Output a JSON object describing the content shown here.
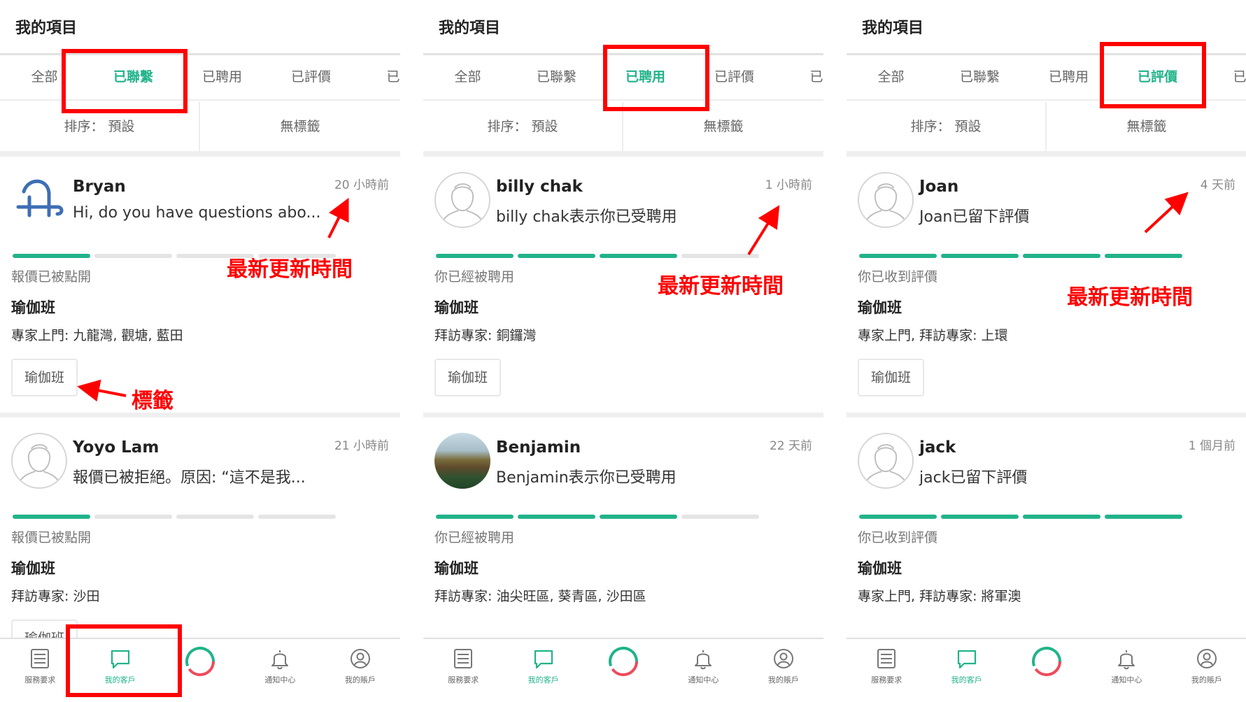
{
  "screens": [
    {
      "title": "我的項目",
      "tabs": [
        "全部",
        "已聯繫",
        "已聘用",
        "已評價",
        "已約"
      ],
      "active_tab": 1,
      "sort_label": "排序： 預設",
      "tag_filter_label": "無標籤",
      "cards": [
        {
          "name": "Bryan",
          "message": "Hi, do you have questions abo...",
          "time": "20 小時前",
          "progress": [
            true,
            false,
            false,
            false
          ],
          "status": "報價已被點開",
          "service": "瑜伽班",
          "location": "專家上門: 九龍灣, 觀塘, 藍田",
          "tag": "瑜伽班",
          "avatar": "logo"
        },
        {
          "name": "Yoyo Lam",
          "message": "報價已被拒絕。原因: “這不是我...",
          "time": "21 小時前",
          "progress": [
            true,
            false,
            false,
            false
          ],
          "status": "報價已被點開",
          "service": "瑜伽班",
          "location": "拜訪專家: 沙田",
          "tag": "瑜伽班",
          "avatar": "placeholder"
        }
      ],
      "bottom_nav": [
        "服務要求",
        "我的客戶",
        "",
        "通知中心",
        "我的賬戶"
      ],
      "nav_active": 1
    },
    {
      "title": "我的項目",
      "tabs": [
        "全部",
        "已聯繫",
        "已聘用",
        "已評價",
        "已約"
      ],
      "active_tab": 2,
      "sort_label": "排序： 預設",
      "tag_filter_label": "無標籤",
      "cards": [
        {
          "name": "billy chak",
          "message": "billy chak表示你已受聘用",
          "time": "1 小時前",
          "progress": [
            true,
            true,
            true,
            false
          ],
          "status": "你已經被聘用",
          "service": "瑜伽班",
          "location": "拜訪專家: 銅鑼灣",
          "tag": "瑜伽班",
          "avatar": "placeholder"
        },
        {
          "name": "Benjamin",
          "message": "Benjamin表示你已受聘用",
          "time": "22 天前",
          "progress": [
            true,
            true,
            true,
            false
          ],
          "status": "你已經被聘用",
          "service": "瑜伽班",
          "location": "拜訪專家: 油尖旺區, 葵青區, 沙田區",
          "tag": "",
          "avatar": "photo"
        }
      ],
      "bottom_nav": [
        "服務要求",
        "我的客戶",
        "",
        "通知中心",
        "我的賬戶"
      ],
      "nav_active": 1
    },
    {
      "title": "我的項目",
      "tabs": [
        "全部",
        "已聯繫",
        "已聘用",
        "已評價",
        "已約"
      ],
      "active_tab": 3,
      "sort_label": "排序： 預設",
      "tag_filter_label": "無標籤",
      "cards": [
        {
          "name": "Joan",
          "message": "Joan已留下評價",
          "time": "4 天前",
          "progress": [
            true,
            true,
            true,
            true
          ],
          "status": "你已收到評價",
          "service": "瑜伽班",
          "location": "專家上門, 拜訪專家: 上環",
          "tag": "瑜伽班",
          "avatar": "placeholder"
        },
        {
          "name": "jack",
          "message": "jack已留下評價",
          "time": "1 個月前",
          "progress": [
            true,
            true,
            true,
            true
          ],
          "status": "你已收到評價",
          "service": "瑜伽班",
          "location": "專家上門, 拜訪專家: 將軍澳",
          "tag": "",
          "avatar": "placeholder"
        }
      ],
      "bottom_nav": [
        "服務要求",
        "我的客戶",
        "",
        "通知中心",
        "我的賬戶"
      ],
      "nav_active": 1
    }
  ],
  "annotations": {
    "latest_update": "最新更新時間",
    "tag": "標籤"
  },
  "colors": {
    "accent": "#21b38a",
    "highlight": "#ff0000",
    "progress_off": "#e4e4e4"
  }
}
